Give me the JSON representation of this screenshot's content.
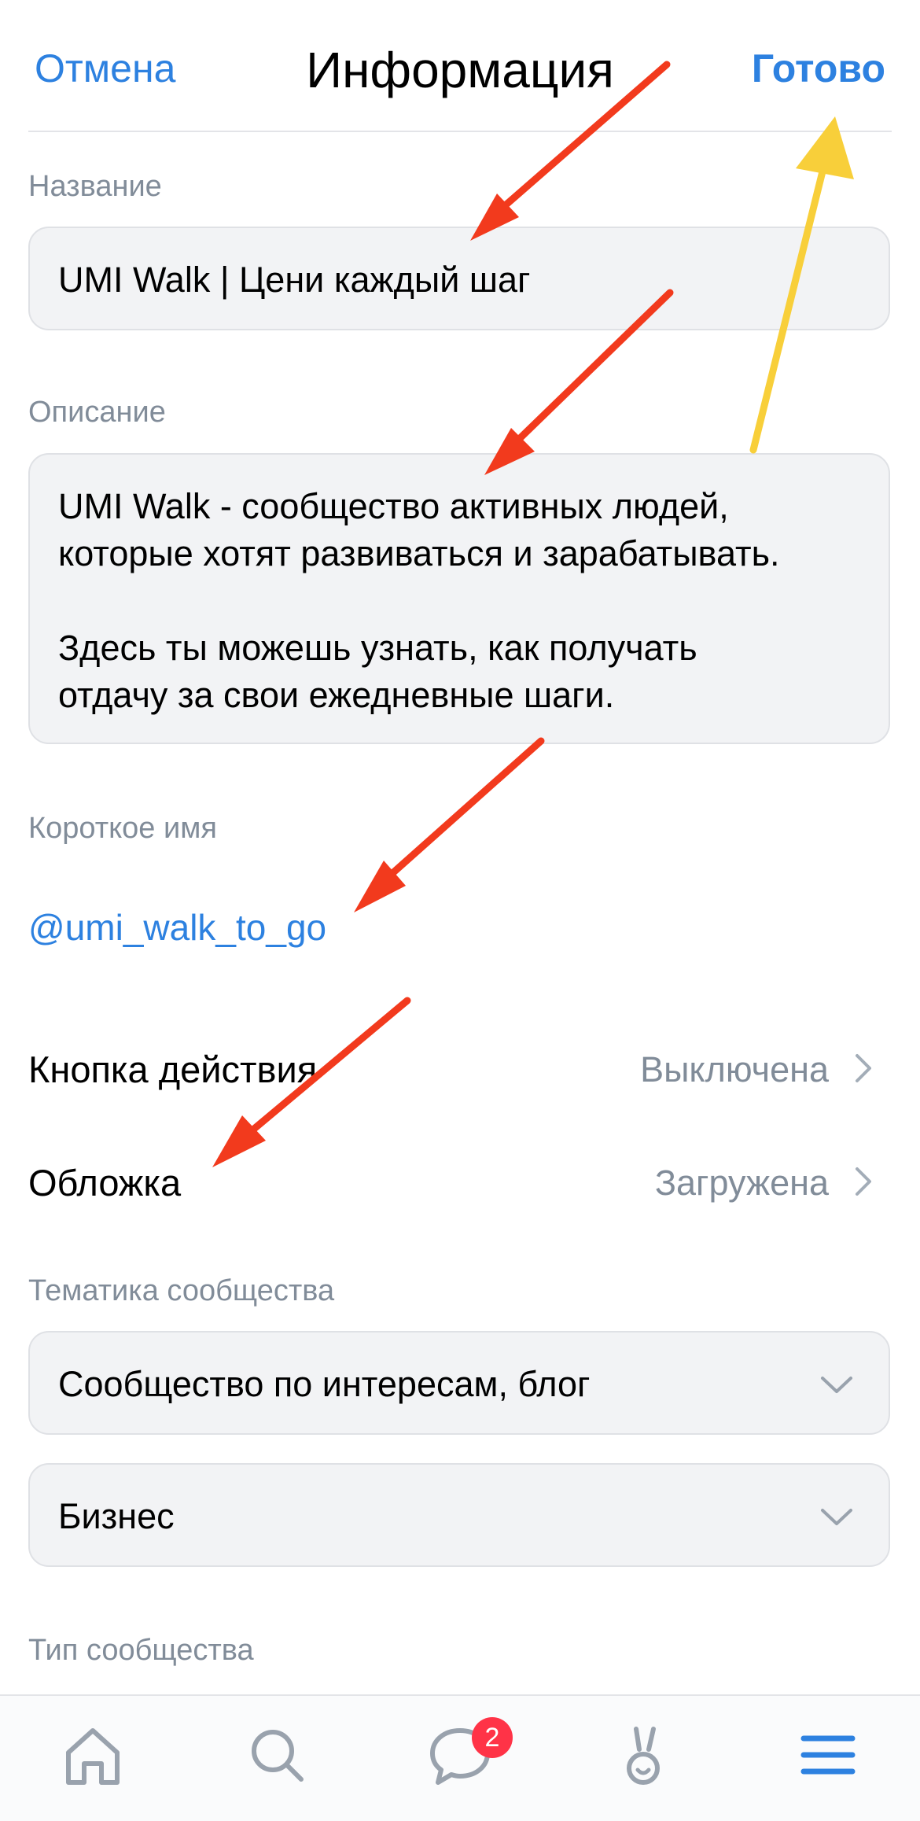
{
  "header": {
    "cancel_label": "Отмена",
    "title": "Информация",
    "done_label": "Готово"
  },
  "name_section": {
    "label": "Название",
    "value": "UMI Walk | Цени каждый шаг"
  },
  "description_section": {
    "label": "Описание",
    "line1": "UMI Walk - сообщество активных людей,",
    "line2": "которые хотят развиваться и зарабатывать.",
    "line3": "Здесь ты можешь узнать, как получать",
    "line4": "отдачу за свои ежедневные шаги."
  },
  "short_name_section": {
    "label": "Короткое имя",
    "value": "@umi_walk_to_go"
  },
  "action_button_row": {
    "label": "Кнопка действия",
    "value": "Выключена"
  },
  "cover_row": {
    "label": "Обложка",
    "value": "Загружена"
  },
  "topic_section": {
    "label": "Тематика сообщества",
    "primary_selected": "Сообщество по интересам, блог",
    "secondary_selected": "Бизнес"
  },
  "type_section": {
    "label": "Тип сообщества"
  },
  "tabbar": {
    "tabs": [
      {
        "icon": "home-icon"
      },
      {
        "icon": "search-icon"
      },
      {
        "icon": "messages-icon",
        "badge": "2"
      },
      {
        "icon": "clips-icon"
      },
      {
        "icon": "menu-icon"
      }
    ],
    "messages_badge": "2"
  },
  "colors": {
    "accent": "#2d81e0",
    "secondary_text": "#818c99",
    "field_background": "#f2f3f5",
    "badge": "#ff3347",
    "annotation_red": "#f23a1d",
    "annotation_yellow": "#f8cf3a"
  }
}
